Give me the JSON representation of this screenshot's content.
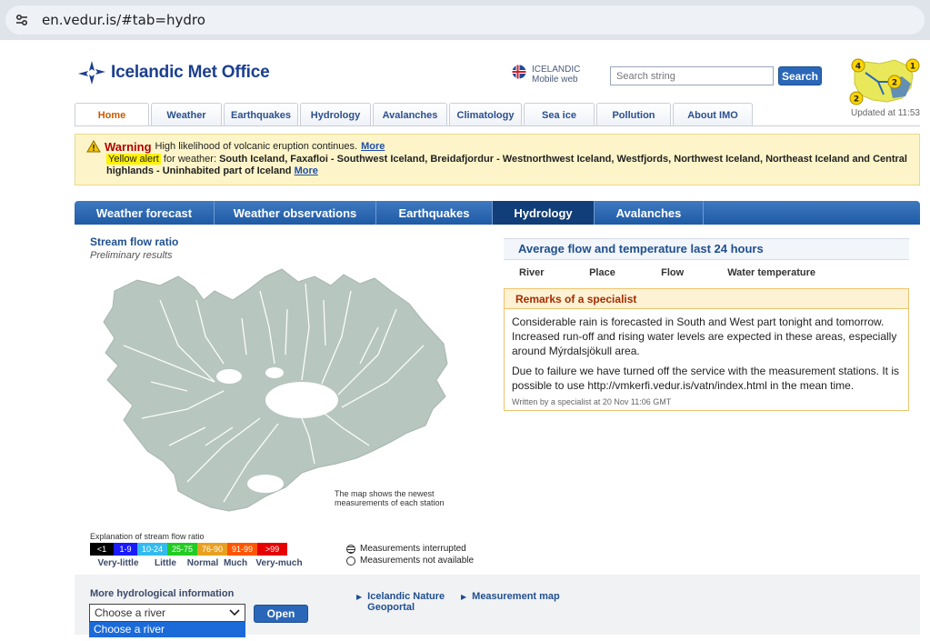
{
  "browser": {
    "url": "en.vedur.is/#tab=hydro"
  },
  "header": {
    "logo_text": "Icelandic Met Office",
    "language": "ICELANDIC",
    "mobile": "Mobile web",
    "search_placeholder": "Search string",
    "search_label": "Search",
    "updated": "Updated at 11:53",
    "map_badges": [
      "4",
      "1",
      "2",
      "2"
    ]
  },
  "nav": [
    "Home",
    "Weather",
    "Earthquakes",
    "Hydrology",
    "Avalanches",
    "Climatology",
    "Sea ice",
    "Pollution",
    "About IMO"
  ],
  "warning": {
    "title": "Warning",
    "text": "High likelihood of volcanic eruption continues.",
    "more": "More",
    "tag": "Yellow alert",
    "for": "for weather:",
    "areas": "South Iceland, Faxafloi - Southwest Iceland, Breidafjordur - Westnorthwest Iceland, Westfjords, Northwest Iceland, Northeast Iceland and Central highlands - Uninhabited part of Iceland",
    "more2": "More"
  },
  "subnav": [
    "Weather forecast",
    "Weather observations",
    "Earthquakes",
    "Hydrology",
    "Avalanches"
  ],
  "stream": {
    "title": "Stream flow ratio",
    "subtitle": "Preliminary results",
    "map_note": "The map shows the newest measurements of each station",
    "legend_title": "Explanation of stream flow ratio",
    "legend": [
      {
        "label": "<1",
        "color": "#000000",
        "text": "#ffffff"
      },
      {
        "label": "1-9",
        "color": "#1a1aff",
        "text": "#ffffff"
      },
      {
        "label": "10-24",
        "color": "#33bbee",
        "text": "#ffffff"
      },
      {
        "label": "25-75",
        "color": "#22cc22",
        "text": "#ffffff"
      },
      {
        "label": "76-90",
        "color": "#e8a020",
        "text": "#ffffff"
      },
      {
        "label": "91-99",
        "color": "#ff5500",
        "text": "#ffffff"
      },
      {
        "label": ">99",
        "color": "#e60000",
        "text": "#ffffff"
      }
    ],
    "words": [
      "Very-little",
      "Little",
      "Normal",
      "Much",
      "Very-much"
    ],
    "interrupted": "Measurements interrupted",
    "not_available": "Measurements not available"
  },
  "avg": {
    "title": "Average flow and temperature last 24 hours",
    "headers": [
      "River",
      "Place",
      "Flow",
      "Water temperature"
    ]
  },
  "remarks": {
    "title": "Remarks of a specialist",
    "p1": "Considerable rain is forecasted in South and West part tonight and tomorrow. Increased run-off and rising water levels are expected in these areas, especially around Mýrdalsjökull area.",
    "p2": "Due to failure we have turned off the service with the measurement stations. It is possible to use http://vmkerfi.vedur.is/vatn/index.html in the mean time.",
    "footer": "Written by a specialist at 20 Nov 11:06 GMT"
  },
  "bottom": {
    "title": "More hydrological information",
    "select_value": "Choose a river",
    "dropdown_option": "Choose a river",
    "open_label": "Open",
    "link1": "Icelandic Nature Geoportal",
    "link2": "Measurement map"
  }
}
